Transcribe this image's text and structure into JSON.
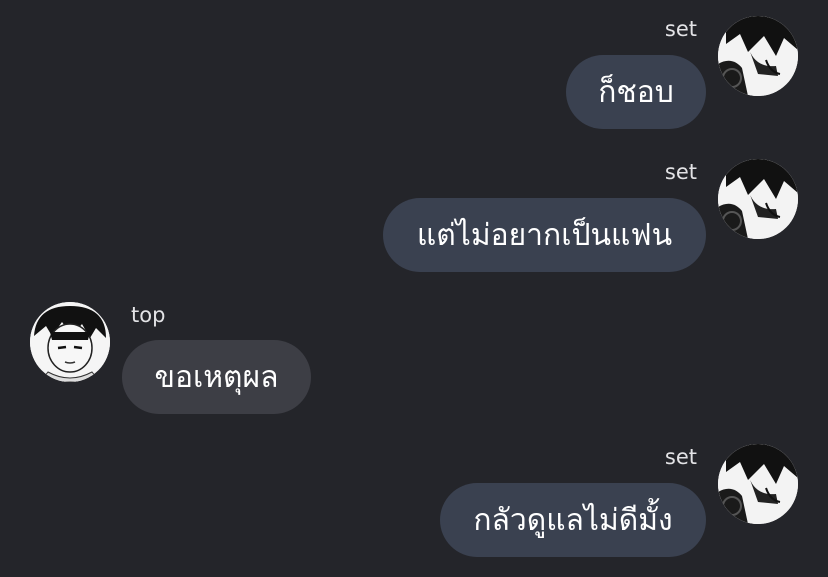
{
  "messages": [
    {
      "sender": "set",
      "text": "ก็ชอบ",
      "direction": "outgoing"
    },
    {
      "sender": "set",
      "text": "แต่ไม่อยากเป็นแฟน",
      "direction": "outgoing"
    },
    {
      "sender": "top",
      "text": "ขอเหตุผล",
      "direction": "incoming"
    },
    {
      "sender": "set",
      "text": "กลัวดูแลไม่ดีมั้ง",
      "direction": "outgoing"
    }
  ],
  "colors": {
    "background": "#24252a",
    "outgoing_bubble": "#3a4150",
    "incoming_bubble": "#3d3e45",
    "name_text": "#e3e3e6",
    "message_text": "#ffffff"
  },
  "icons": {
    "set_avatar": "manga-avatar-dark-hair-profile",
    "top_avatar": "manga-avatar-front-face"
  }
}
